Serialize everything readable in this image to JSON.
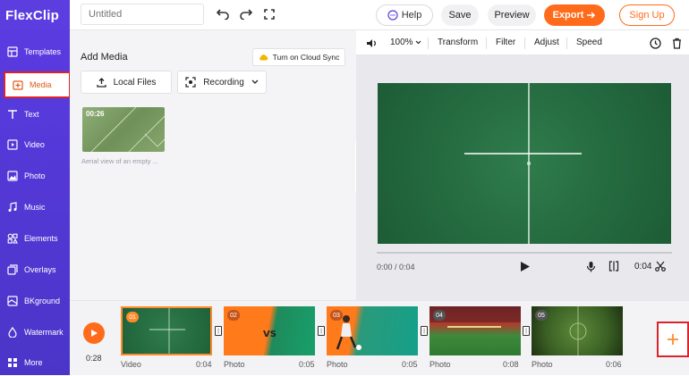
{
  "app": {
    "logo": "FlexClip"
  },
  "topbar": {
    "title_placeholder": "Untitled",
    "help_label": "Help",
    "save_label": "Save",
    "preview_label": "Preview",
    "export_label": "Export",
    "signup_label": "Sign Up"
  },
  "sidebar": {
    "items": [
      {
        "label": "Templates",
        "icon": "templates-icon"
      },
      {
        "label": "Media",
        "icon": "media-icon",
        "active": true
      },
      {
        "label": "Text",
        "icon": "text-icon"
      },
      {
        "label": "Video",
        "icon": "video-icon"
      },
      {
        "label": "Photo",
        "icon": "photo-icon"
      },
      {
        "label": "Music",
        "icon": "music-icon"
      },
      {
        "label": "Elements",
        "icon": "elements-icon"
      },
      {
        "label": "Overlays",
        "icon": "overlays-icon"
      },
      {
        "label": "BKground",
        "icon": "background-icon"
      },
      {
        "label": "Watermark",
        "icon": "watermark-icon"
      },
      {
        "label": "More",
        "icon": "more-icon"
      }
    ]
  },
  "media": {
    "title": "Add Media",
    "cloud_sync_label": "Turn on Cloud Sync",
    "local_files_label": "Local Files",
    "recording_label": "Recording",
    "item": {
      "duration": "00:26",
      "caption": "Aerial view of an empty ..."
    }
  },
  "preview": {
    "zoom": "100%",
    "transform_label": "Transform",
    "filter_label": "Filter",
    "adjust_label": "Adjust",
    "speed_label": "Speed",
    "time_current": "0:00 / 0:04",
    "time_right": "0:04"
  },
  "timeline": {
    "total_time": "0:28",
    "clips": [
      {
        "num": "01",
        "type": "Video",
        "duration": "0:04"
      },
      {
        "num": "02",
        "type": "Photo",
        "duration": "0:05"
      },
      {
        "num": "03",
        "type": "Photo",
        "duration": "0:05"
      },
      {
        "num": "04",
        "type": "Photo",
        "duration": "0:08"
      },
      {
        "num": "05",
        "type": "Photo",
        "duration": "0:06"
      }
    ]
  },
  "colors": {
    "accent": "#ff6b1a",
    "sidebar": "#5a3be0",
    "highlight": "#d9242c"
  }
}
